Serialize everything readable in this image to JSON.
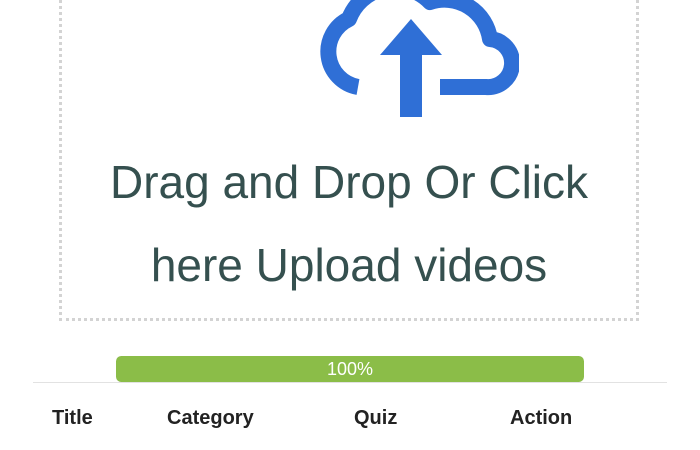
{
  "upload": {
    "icon": "cloud-upload-icon",
    "line1": "Drag and Drop Or Click",
    "line2": "here Upload videos"
  },
  "progress": {
    "value": 1.0,
    "label": "100%"
  },
  "table": {
    "headers": [
      "Title",
      "Category",
      "Quiz",
      "Action"
    ]
  },
  "colors": {
    "icon": "#2f6fd6",
    "text": "#35504f",
    "progress_fill": "#8bbd48"
  }
}
